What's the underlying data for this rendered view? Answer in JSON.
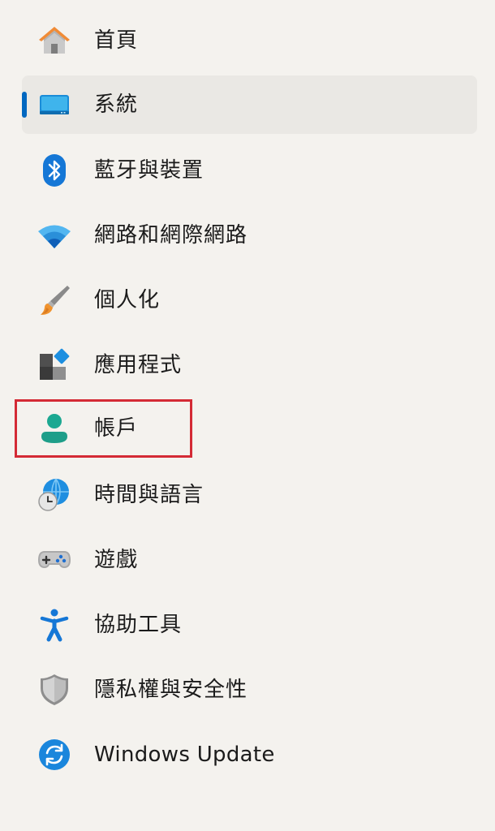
{
  "sidebar": {
    "selected_index": 1,
    "highlighted_index": 6,
    "accent_color": "#0067c0",
    "highlight_color": "#d42a35",
    "items": [
      {
        "label": "首頁",
        "icon": "home-icon"
      },
      {
        "label": "系統",
        "icon": "system-display-icon"
      },
      {
        "label": "藍牙與裝置",
        "icon": "bluetooth-icon"
      },
      {
        "label": "網路和網際網路",
        "icon": "wifi-icon"
      },
      {
        "label": "個人化",
        "icon": "paintbrush-icon"
      },
      {
        "label": "應用程式",
        "icon": "apps-icon"
      },
      {
        "label": "帳戶",
        "icon": "account-person-icon"
      },
      {
        "label": "時間與語言",
        "icon": "globe-clock-icon"
      },
      {
        "label": "遊戲",
        "icon": "gamepad-icon"
      },
      {
        "label": "協助工具",
        "icon": "accessibility-icon"
      },
      {
        "label": "隱私權與安全性",
        "icon": "shield-icon"
      },
      {
        "label": "Windows Update",
        "icon": "windows-update-icon"
      }
    ]
  }
}
